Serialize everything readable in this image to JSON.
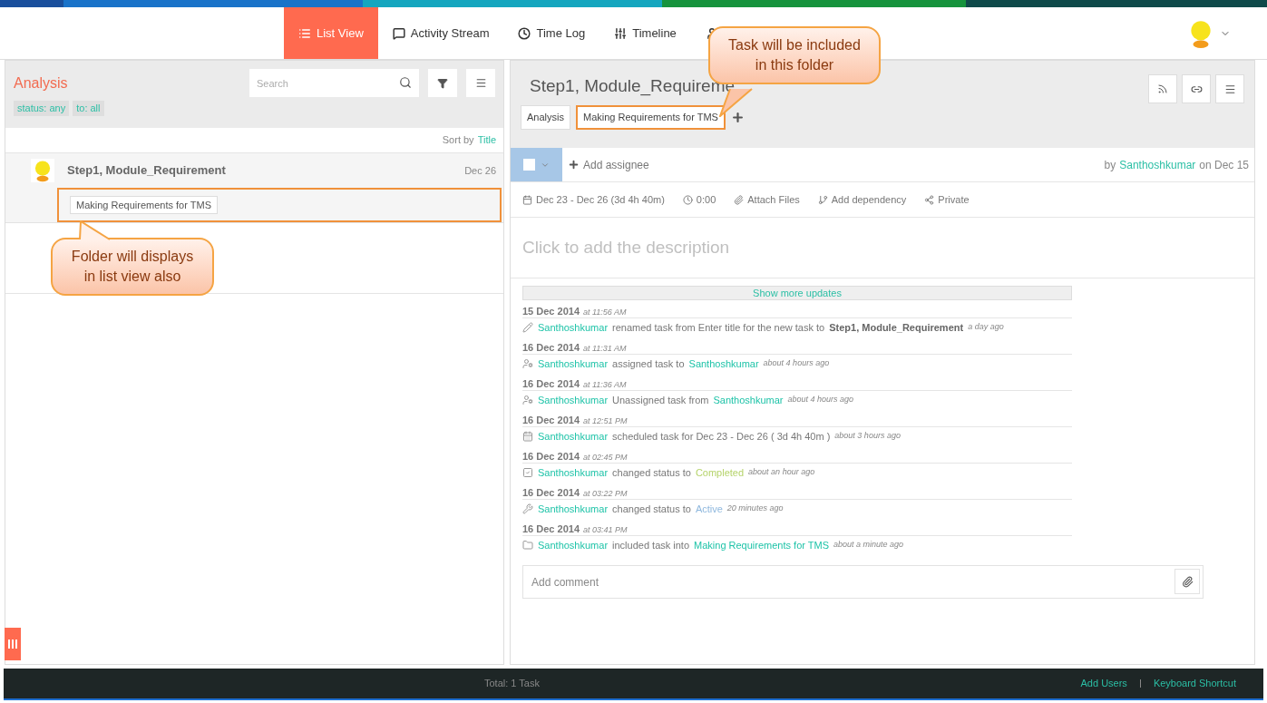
{
  "nav": {
    "tabs": [
      {
        "label": "List View",
        "kind": "list",
        "selected": true
      },
      {
        "label": "Activity Stream",
        "kind": "comment",
        "selected": false
      },
      {
        "label": "Time Log",
        "kind": "clock",
        "selected": false
      },
      {
        "label": "Timeline",
        "kind": "sliders",
        "selected": false
      },
      {
        "kind": "user",
        "selected": false
      }
    ]
  },
  "list_panel": {
    "title": "Analysis",
    "search": {
      "placeholder": "Search"
    },
    "filters": [
      "status: any",
      "to: all"
    ],
    "sort": {
      "label": "Sort by",
      "value": "Title"
    },
    "tasks": [
      {
        "title": "Step1, Module_Requirement",
        "date": "Dec 26",
        "folder": "Making Requirements for TMS",
        "highlighted": true
      }
    ]
  },
  "task_panel": {
    "title": "Step1, Module_Requireme",
    "folders": [
      {
        "label": "Analysis",
        "highlighted": false
      },
      {
        "label": "Making Requirements for TMS",
        "highlighted": true
      }
    ],
    "checked": false,
    "add_assignee": "Add assignee",
    "author": {
      "prefix": "by",
      "name": "Santhoshkumar",
      "suffix": "on Dec 15"
    },
    "meta": [
      {
        "kind": "calendar",
        "label": "Dec 23 - Dec 26 (3d 4h 40m)"
      },
      {
        "kind": "clock",
        "label": "0:00"
      },
      {
        "kind": "paperclip",
        "label": "Attach Files"
      },
      {
        "kind": "dependency",
        "label": "Add dependency"
      },
      {
        "kind": "share",
        "label": "Private"
      }
    ],
    "description_placeholder": "Click to add the description",
    "show_more": "Show more updates",
    "updates": [
      {
        "date": "15 Dec 2014",
        "time": "at 11:56 AM",
        "kind": "pencil",
        "parts": [
          {
            "kind": "link",
            "text": "Santhoshkumar"
          },
          {
            "kind": "plain",
            "text": "renamed task from Enter title for the new task to"
          },
          {
            "kind": "bold",
            "text": "Step1, Module_Requirement"
          }
        ],
        "ago": "a day ago"
      },
      {
        "date": "16 Dec 2014",
        "time": "at 11:31 AM",
        "kind": "assign",
        "parts": [
          {
            "kind": "link",
            "text": "Santhoshkumar"
          },
          {
            "kind": "plain",
            "text": "assigned task to"
          },
          {
            "kind": "link",
            "text": "Santhoshkumar"
          }
        ],
        "ago": "about 4 hours ago"
      },
      {
        "date": "16 Dec 2014",
        "time": "at 11:36 AM",
        "kind": "assign",
        "parts": [
          {
            "kind": "link",
            "text": "Santhoshkumar"
          },
          {
            "kind": "plain",
            "text": "Unassigned task from"
          },
          {
            "kind": "link",
            "text": "Santhoshkumar"
          }
        ],
        "ago": "about 4 hours ago"
      },
      {
        "date": "16 Dec 2014",
        "time": "at 12:51 PM",
        "kind": "calendar",
        "parts": [
          {
            "kind": "link",
            "text": "Santhoshkumar"
          },
          {
            "kind": "plain",
            "text": "scheduled task for Dec 23 - Dec 26 ( 3d 4h 40m )"
          }
        ],
        "ago": "about 3 hours ago"
      },
      {
        "date": "16 Dec 2014",
        "time": "at 02:45 PM",
        "kind": "checkbox",
        "parts": [
          {
            "kind": "link",
            "text": "Santhoshkumar"
          },
          {
            "kind": "plain",
            "text": "changed status to"
          },
          {
            "kind": "completed",
            "text": "Completed"
          }
        ],
        "ago": "about an hour ago"
      },
      {
        "date": "16 Dec 2014",
        "time": "at 03:22 PM",
        "kind": "wrench",
        "parts": [
          {
            "kind": "link",
            "text": "Santhoshkumar"
          },
          {
            "kind": "plain",
            "text": "changed status to"
          },
          {
            "kind": "active",
            "text": "Active"
          }
        ],
        "ago": "20 minutes ago"
      },
      {
        "date": "16 Dec 2014",
        "time": "at 03:41 PM",
        "kind": "folder",
        "parts": [
          {
            "kind": "link",
            "text": "Santhoshkumar"
          },
          {
            "kind": "plain",
            "text": "included task into"
          },
          {
            "kind": "link",
            "text": "Making Requirements for TMS"
          }
        ],
        "ago": "about a minute ago"
      }
    ],
    "comment": {
      "placeholder": "Add comment"
    }
  },
  "footer": {
    "total": "Total: 1 Task",
    "links": [
      "Add Users",
      "Keyboard Shortcut"
    ]
  },
  "annotations": [
    {
      "text": "Task will be included in this folder"
    },
    {
      "text": "Folder will displays in list view also"
    }
  ]
}
